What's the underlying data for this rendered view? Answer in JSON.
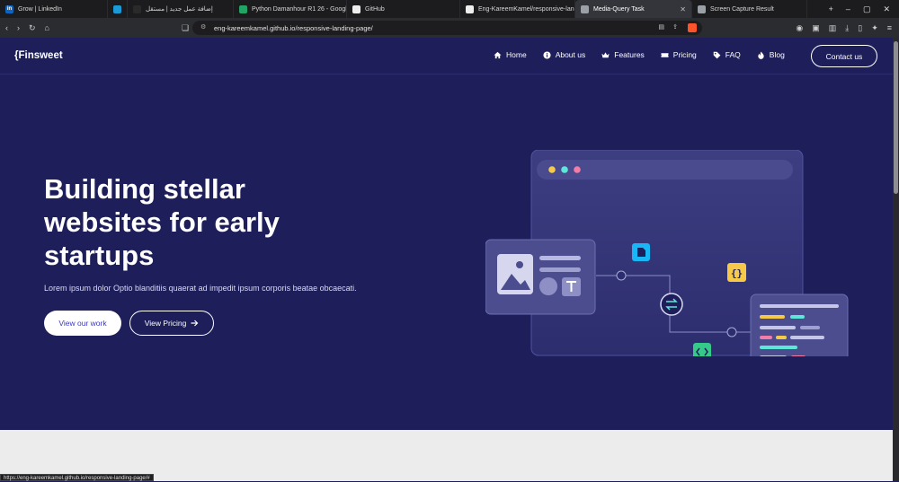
{
  "browser": {
    "tabs": [
      {
        "label": "Grow | LinkedIn",
        "icon": "linkedin-icon",
        "color": "#0a66c2",
        "glyph": "in"
      },
      {
        "label": "",
        "icon": "circle-app-icon",
        "color": "#1a9bd7",
        "glyph": ""
      },
      {
        "label": "إضافة عمل جديد | مستقل",
        "icon": "mostaql-icon",
        "color": "#2a2a2a",
        "glyph": ""
      },
      {
        "label": "Python Damanhour R1 26 - Google S",
        "icon": "sheets-icon",
        "color": "#21a464",
        "glyph": ""
      },
      {
        "label": "GitHub",
        "icon": "github-icon",
        "color": "#eeeeee",
        "glyph": ""
      },
      {
        "label": "Eng-KareemKamel/responsive-landi",
        "icon": "github-icon",
        "color": "#eeeeee",
        "glyph": ""
      },
      {
        "label": "Media-Query Task",
        "icon": "globe-icon",
        "color": "#9aa0a6",
        "glyph": "",
        "active": true
      },
      {
        "label": "Screen Capture Result",
        "icon": "camera-icon",
        "color": "#9aa0a6",
        "glyph": ""
      }
    ],
    "url": "eng-kareemkamel.github.io/responsive-landing-page/",
    "status_url": "https://eng-kareemkamel.github.io/responsive-landing-page/#"
  },
  "site": {
    "logo": "{Finsweet",
    "nav": [
      {
        "label": "Home",
        "icon": "home-icon"
      },
      {
        "label": "About us",
        "icon": "info-icon"
      },
      {
        "label": "Features",
        "icon": "crown-icon"
      },
      {
        "label": "Pricing",
        "icon": "ticket-icon"
      },
      {
        "label": "FAQ",
        "icon": "tag-icon"
      },
      {
        "label": "Blog",
        "icon": "fire-icon"
      }
    ],
    "contact_label": "Contact us",
    "hero": {
      "title_lines": [
        "Building stellar",
        "websites for early",
        "startups"
      ],
      "subtitle": "Lorem ipsum dolor Optio blanditiis quaerat ad impedit ipsum corporis beatae obcaecati.",
      "primary_button": "View our work",
      "secondary_button": "View Pricing",
      "secondary_icon": "arrow-right-icon"
    }
  },
  "colors": {
    "page_bg": "#1e1f5a",
    "primary_text": "#3a36c9",
    "dot_yellow": "#f7c948",
    "dot_teal": "#5ee6d8",
    "dot_pink": "#f27ca8",
    "accent_blue": "#19b6f5",
    "accent_yellow": "#f7c948",
    "accent_green": "#35c98a"
  }
}
